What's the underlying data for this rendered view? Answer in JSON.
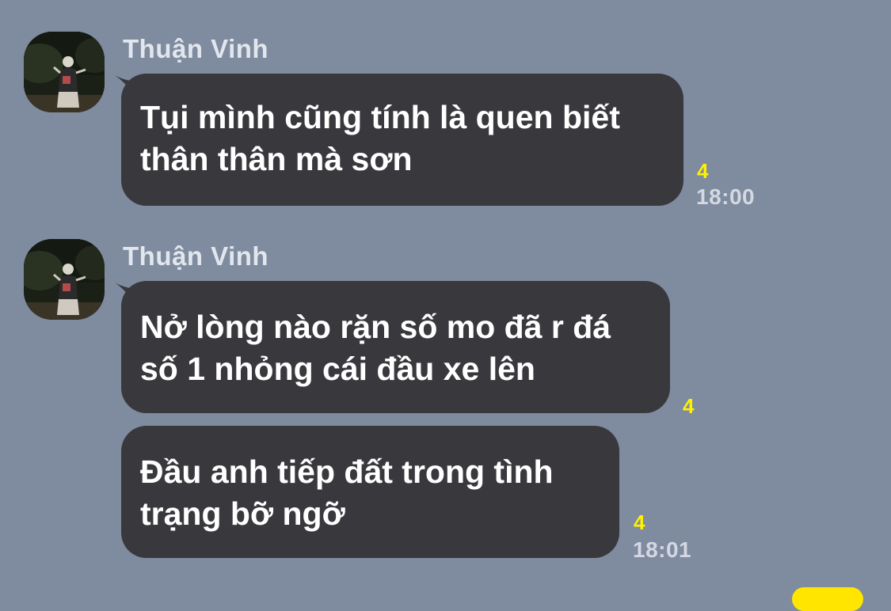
{
  "messages": [
    {
      "sender": "Thuận Vinh",
      "text": "Tụi mình cũng tính là quen biết\nthân thân mà sơn",
      "read_count": "4",
      "time": "18:00"
    },
    {
      "sender": "Thuận Vinh",
      "text": "Nở lòng nào rặn số mo đã r đá\nsố 1 nhỏng cái đầu xe lên",
      "read_count": "4",
      "time": ""
    },
    {
      "sender": "",
      "text": "Đầu anh tiếp đất trong tình\ntrạng bỡ ngỡ",
      "read_count": "4",
      "time": "18:01"
    }
  ],
  "colors": {
    "background": "#7f8b9e",
    "bubble": "#39383d",
    "read_count": "#fff200",
    "timestamp": "#d3d8e2",
    "sent_bubble_peek": "#ffe500"
  },
  "icons": {
    "avatar": "profile-photo-person-at-night"
  }
}
